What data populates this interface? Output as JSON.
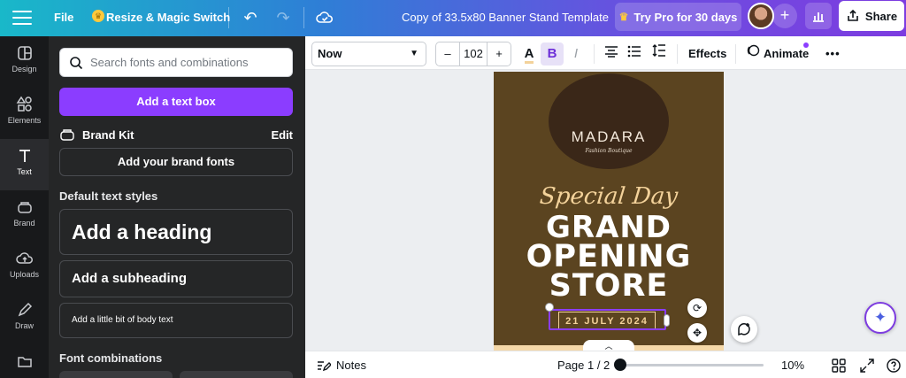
{
  "topbar": {
    "file_label": "File",
    "resize_label": "Resize & Magic Switch",
    "design_title": "Copy of 33.5x80 Banner Stand Template",
    "try_pro_label": "Try Pro for 30 days",
    "share_label": "Share",
    "icons": [
      "menu-icon",
      "crown-icon",
      "undo-icon",
      "redo-icon",
      "cloud-save-icon",
      "avatar",
      "plus-icon",
      "stats-icon",
      "share-icon"
    ]
  },
  "rail": {
    "items": [
      {
        "label": "Design",
        "icon": "design-icon"
      },
      {
        "label": "Elements",
        "icon": "elements-icon"
      },
      {
        "label": "Text",
        "icon": "text-icon",
        "active": true
      },
      {
        "label": "Brand",
        "icon": "brand-icon"
      },
      {
        "label": "Uploads",
        "icon": "uploads-icon"
      },
      {
        "label": "Draw",
        "icon": "draw-icon"
      },
      {
        "label": "",
        "icon": "folder-icon"
      }
    ]
  },
  "panel": {
    "search_placeholder": "Search fonts and combinations",
    "add_text_box": "Add a text box",
    "brand_kit": "Brand Kit",
    "brand_kit_edit": "Edit",
    "add_brand_fonts": "Add your brand fonts",
    "default_styles_title": "Default text styles",
    "add_heading": "Add a heading",
    "add_subheading": "Add a subheading",
    "add_body": "Add a little bit of body text",
    "font_combinations_title": "Font combinations"
  },
  "text_toolbar": {
    "font_name": "Now",
    "font_size": "102",
    "size_minus": "–",
    "size_plus": "+",
    "color_letter": "A",
    "bold_letter": "B",
    "italic_letter": "I",
    "effects_label": "Effects",
    "animate_label": "Animate",
    "more_label": "•••",
    "accent_color": "#8b3dff"
  },
  "canvas": {
    "brand_name": "MADARA",
    "brand_tagline": "Fashion Boutique",
    "special_day": "Special Day",
    "line1": "GRAND",
    "line2": "OPENING",
    "line3": "STORE",
    "date": "21 JULY 2024",
    "design_bg_color": "#5b4420",
    "logo_circle_color": "#3a2718"
  },
  "bottombar": {
    "notes_label": "Notes",
    "page_indicator": "Page 1 / 2",
    "zoom_value": "10%",
    "zoom_fraction": 0.0
  }
}
